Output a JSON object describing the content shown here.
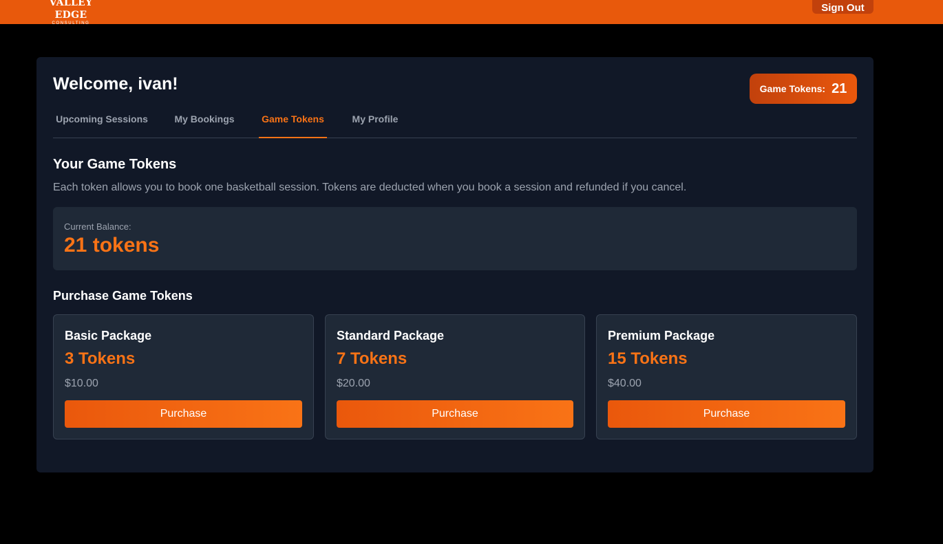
{
  "header": {
    "logo_main": "VALLEY EDGE",
    "logo_sub": "CONSULTING",
    "sign_out_label": "Sign Out"
  },
  "welcome": "Welcome, ivan!",
  "token_badge": {
    "label": "Game Tokens:",
    "value": "21"
  },
  "tabs": [
    {
      "label": "Upcoming Sessions",
      "active": false
    },
    {
      "label": "My Bookings",
      "active": false
    },
    {
      "label": "Game Tokens",
      "active": true
    },
    {
      "label": "My Profile",
      "active": false
    }
  ],
  "tokens_section": {
    "title": "Your Game Tokens",
    "description": "Each token allows you to book one basketball session. Tokens are deducted when you book a session and refunded if you cancel.",
    "balance_label": "Current Balance:",
    "balance_value": "21 tokens"
  },
  "purchase": {
    "title": "Purchase Game Tokens",
    "packages": [
      {
        "name": "Basic Package",
        "tokens": "3 Tokens",
        "price": "$10.00",
        "button": "Purchase"
      },
      {
        "name": "Standard Package",
        "tokens": "7 Tokens",
        "price": "$20.00",
        "button": "Purchase"
      },
      {
        "name": "Premium Package",
        "tokens": "15 Tokens",
        "price": "$40.00",
        "button": "Purchase"
      }
    ]
  },
  "colors": {
    "brand_orange": "#e8590c",
    "accent_orange": "#f97316",
    "panel_bg": "#111827",
    "card_bg": "#1f2937"
  }
}
